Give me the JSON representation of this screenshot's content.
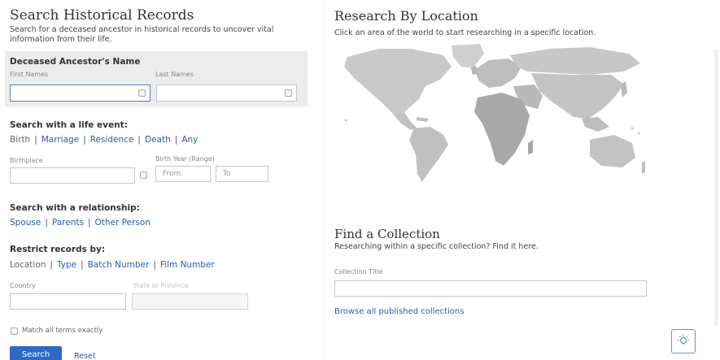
{
  "search": {
    "title": "Search Historical Records",
    "subtitle": "Search for a deceased ancestor in historical records to uncover vital information from their life.",
    "name_section": {
      "title": "Deceased Ancestor's Name",
      "first_label": "First Names",
      "last_label": "Last Names"
    },
    "life_event": {
      "title": "Search with a life event:",
      "options": [
        "Birth",
        "Marriage",
        "Residence",
        "Death",
        "Any"
      ],
      "birthplace_label": "Birthplace",
      "birth_year_label": "Birth Year (Range)",
      "from_placeholder": "From",
      "to_placeholder": "To"
    },
    "relationship": {
      "title": "Search with a relationship:",
      "options": [
        "Spouse",
        "Parents",
        "Other Person"
      ]
    },
    "restrict": {
      "title": "Restrict records by:",
      "options": [
        "Location",
        "Type",
        "Batch Number",
        "Film Number"
      ],
      "country_label": "Country",
      "state_label": "State or Province"
    },
    "match_label": "Match all terms exactly",
    "search_button": "Search",
    "reset_link": "Reset"
  },
  "location": {
    "title": "Research By Location",
    "subtitle": "Click an area of the world to start researching in a specific location.",
    "map_icon": "world-map"
  },
  "collection": {
    "title": "Find a Collection",
    "subtitle": "Researching within a specific collection? Find it here.",
    "field_label": "Collection Title",
    "browse_link": "Browse all published collections"
  },
  "help_icon": "lightbulb-icon",
  "colors": {
    "link": "#2a5caa",
    "button": "#2f69c6",
    "panel": "#ececec",
    "map_gray": "#bdbdbd"
  }
}
